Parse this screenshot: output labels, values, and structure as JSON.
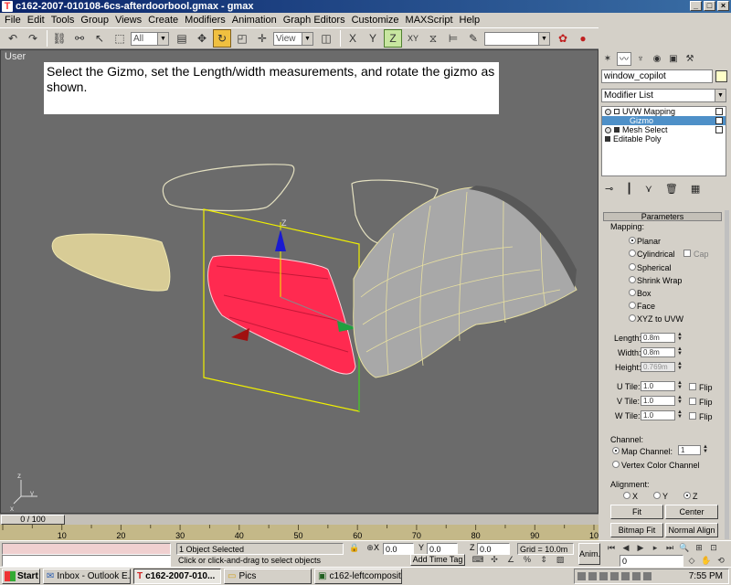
{
  "window": {
    "title": "c162-2007-010108-6cs-afterdoorbool.gmax - gmax",
    "app_icon": "gmax-app-icon"
  },
  "menu": [
    "File",
    "Edit",
    "Tools",
    "Group",
    "Views",
    "Create",
    "Modifiers",
    "Animation",
    "Graph Editors",
    "Customize",
    "MAXScript",
    "Help"
  ],
  "toolbar": {
    "selection_filter": "All",
    "reference_coord": "View",
    "axis_constraints": [
      "X",
      "Y",
      "Z",
      "XY"
    ],
    "named_selection": ""
  },
  "viewport": {
    "label": "User",
    "instruction": "Select the Gizmo, set the Length/width measurements, and rotate the gizmo as shown.",
    "gizmo_axes": {
      "z": "Z",
      "y": "Y"
    },
    "axis_tripod": {
      "x": "x",
      "y": "y",
      "z": "z"
    }
  },
  "command_panel": {
    "object_name": "window_copilot",
    "object_color": "#ffffc8",
    "modifier_list_label": "Modifier List",
    "stack": [
      {
        "label": "UVW Mapping",
        "level": 0,
        "selected": false
      },
      {
        "label": "Gizmo",
        "level": 1,
        "selected": true
      },
      {
        "label": "Mesh Select",
        "level": 0,
        "selected": false
      },
      {
        "label": "Editable Poly",
        "level": 0,
        "selected": false
      }
    ],
    "parameters": {
      "title": "Parameters",
      "mapping_label": "Mapping:",
      "mapping_types": [
        "Planar",
        "Cylindrical",
        "Spherical",
        "Shrink Wrap",
        "Box",
        "Face",
        "XYZ to UVW"
      ],
      "selected_mapping": "Planar",
      "cap_label": "Cap",
      "length_label": "Length:",
      "length": "0.8m",
      "width_label": "Width:",
      "width": "0.8m",
      "height_label": "Height:",
      "height": "0.769m",
      "u_tile_label": "U Tile:",
      "u_tile": "1.0",
      "v_tile_label": "V Tile:",
      "v_tile": "1.0",
      "w_tile_label": "W Tile:",
      "w_tile": "1.0",
      "flip_label": "Flip",
      "channel_label": "Channel:",
      "map_channel_label": "Map Channel:",
      "map_channel": "1",
      "vertex_color_label": "Vertex Color Channel",
      "alignment_label": "Alignment:",
      "align_axes": [
        "X",
        "Y",
        "Z"
      ],
      "selected_axis": "Z",
      "fit_button": "Fit",
      "center_button": "Center",
      "bitmap_fit_button": "Bitmap Fit",
      "normal_align_button": "Normal Align"
    }
  },
  "time_slider": {
    "label": "0 / 100",
    "ticks": [
      "10",
      "20",
      "30",
      "40",
      "50",
      "60",
      "70",
      "80",
      "90",
      "100"
    ]
  },
  "status": {
    "selection": "1 Object Selected",
    "prompt": "Click or click-and-drag to select objects",
    "x_value": "0.0",
    "y_value": "0.0",
    "z_value": "0.0",
    "grid": "Grid = 10.0m",
    "add_time_tag": "Add Time Tag",
    "anim_label": "Anim.",
    "frame": "0"
  },
  "taskbar": {
    "start_label": "Start",
    "tasks": [
      {
        "label": "Inbox - Outlook E...",
        "active": false
      },
      {
        "label": "c162-2007-010...",
        "active": true
      },
      {
        "label": "Pics",
        "active": false
      },
      {
        "label": "c162-leftcomposit...",
        "active": false
      }
    ],
    "clock": "7:55 PM"
  },
  "colors": {
    "viewport_bg": "#6b6b6b",
    "window_red": "#ff2a50",
    "gizmo_yellow": "#f0f000",
    "selection_blue": "#4e90c8"
  }
}
